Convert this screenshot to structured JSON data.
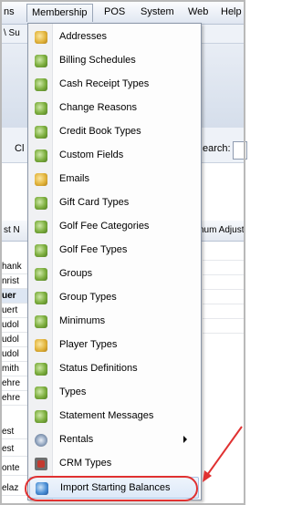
{
  "menubar": {
    "items": [
      {
        "label": "ns"
      },
      {
        "label": "Membership"
      },
      {
        "label": "POS"
      },
      {
        "label": "System"
      },
      {
        "label": "Web"
      },
      {
        "label": "Help"
      }
    ]
  },
  "background": {
    "toolbar_fragment": "\\ Su",
    "filter_left_fragment": "Cl",
    "search_label_fragment": "earch:",
    "grid_head_left_fragment": "st N",
    "grid_head_right_fragment": "num Adjust",
    "row_fragments": [
      "hank",
      "nrist",
      "uer",
      "uert",
      "udol",
      "udol",
      "udol",
      "mith",
      "ehre",
      "ehre",
      "est",
      "est",
      "onte",
      "elaz"
    ]
  },
  "dropdown": {
    "items": [
      {
        "label": "Addresses",
        "icon": "gold-icon",
        "color": "gold"
      },
      {
        "label": "Billing Schedules",
        "icon": "green-icon",
        "color": "green"
      },
      {
        "label": "Cash Receipt Types",
        "icon": "green-icon",
        "color": "green"
      },
      {
        "label": "Change Reasons",
        "icon": "green-icon",
        "color": "green"
      },
      {
        "label": "Credit Book Types",
        "icon": "green-icon",
        "color": "green"
      },
      {
        "label": "Custom Fields",
        "icon": "green-icon",
        "color": "green"
      },
      {
        "label": "Emails",
        "icon": "gold-icon",
        "color": "gold"
      },
      {
        "label": "Gift Card Types",
        "icon": "green-icon",
        "color": "green"
      },
      {
        "label": "Golf Fee Categories",
        "icon": "green-icon",
        "color": "green"
      },
      {
        "label": "Golf Fee Types",
        "icon": "green-icon",
        "color": "green"
      },
      {
        "label": "Groups",
        "icon": "green-icon",
        "color": "green"
      },
      {
        "label": "Group Types",
        "icon": "green-icon",
        "color": "green"
      },
      {
        "label": "Minimums",
        "icon": "green-icon",
        "color": "green"
      },
      {
        "label": "Player Types",
        "icon": "gold-icon",
        "color": "gold"
      },
      {
        "label": "Status Definitions",
        "icon": "green-icon",
        "color": "green"
      },
      {
        "label": "Types",
        "icon": "green-icon",
        "color": "green"
      },
      {
        "label": "Statement Messages",
        "icon": "green-icon",
        "color": "green"
      },
      {
        "label": "Rentals",
        "icon": "gear-icon",
        "color": "gear",
        "submenu": true
      },
      {
        "label": "CRM Types",
        "icon": "crm-icon",
        "color": "crm"
      },
      {
        "label": "Import Starting Balances",
        "icon": "blue-icon",
        "color": "blue",
        "highlighted": true
      }
    ]
  },
  "colors": {
    "annotation": "#e03131",
    "highlight_border": "#aac4e6"
  }
}
